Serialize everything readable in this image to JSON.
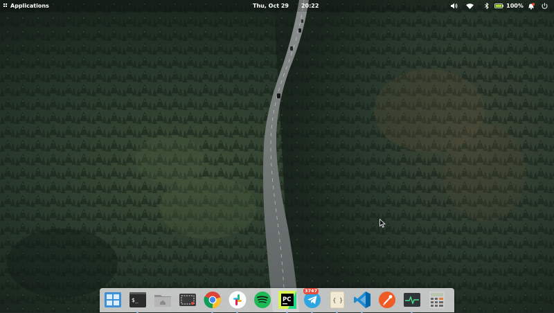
{
  "panel": {
    "applications_label": "Applications",
    "date": "Thu, Oct 29",
    "time": "20:22",
    "battery_percent": "100%",
    "indicators": [
      "volume-icon",
      "wifi-icon",
      "bluetooth-icon",
      "battery-icon",
      "notifications-icon",
      "power-icon"
    ]
  },
  "dock": {
    "items": [
      {
        "icon": "multitasking-view-icon",
        "running": false
      },
      {
        "icon": "terminal-icon",
        "running": true
      },
      {
        "icon": "files-icon",
        "running": false
      },
      {
        "icon": "screenshot-icon",
        "running": false
      },
      {
        "icon": "chrome-icon",
        "running": true
      },
      {
        "icon": "slack-icon",
        "running": true
      },
      {
        "icon": "spotify-icon",
        "running": false
      },
      {
        "icon": "pycharm-icon",
        "running": true
      },
      {
        "icon": "telegram-icon",
        "running": true,
        "badge": "3747"
      },
      {
        "icon": "code-editor-icon",
        "running": true
      },
      {
        "icon": "vscode-icon",
        "running": true
      },
      {
        "icon": "postman-icon",
        "running": false
      },
      {
        "icon": "system-monitor-icon",
        "running": true
      },
      {
        "icon": "calculator-icon",
        "running": false
      }
    ],
    "terminal_glyph": "$_",
    "pycharm_text": "PC",
    "code_editor_text": "{ }"
  },
  "colors": {
    "forest_dark": "#1c2a20",
    "forest_mid": "#2c3d2f",
    "road": "#6e7373",
    "panel_text": "#ffffff",
    "badge": "#e74c3c"
  }
}
